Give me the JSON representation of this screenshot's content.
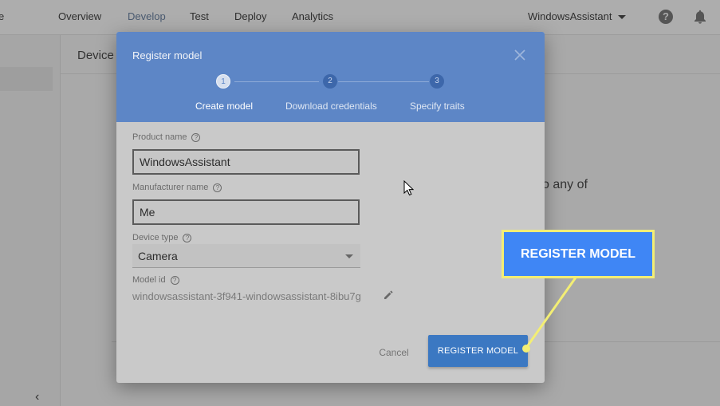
{
  "topnav": {
    "partial_label": "e",
    "items": [
      "Overview",
      "Develop",
      "Test",
      "Deploy",
      "Analytics"
    ],
    "active": "Develop",
    "project": "WindowsAssistant",
    "help_icon": "question-mark-icon",
    "bell_icon": "bell-icon"
  },
  "page": {
    "title": "Device",
    "partial_text": "o any of",
    "collapse_icon": "chevron-left-icon"
  },
  "modal": {
    "title": "Register model",
    "steps": [
      {
        "number": "1",
        "label": "Create model"
      },
      {
        "number": "2",
        "label": "Download credentials"
      },
      {
        "number": "3",
        "label": "Specify traits"
      }
    ],
    "product_name_label": "Product name",
    "product_name_value": "WindowsAssistant",
    "manufacturer_name_label": "Manufacturer name",
    "manufacturer_name_value": "Me",
    "device_type_label": "Device type",
    "device_type_value": "Camera",
    "model_id_label": "Model id",
    "model_id_value": "windowsassistant-3f941-windowsassistant-8ibu7g",
    "cancel_label": "Cancel",
    "register_label": "REGISTER MODEL"
  },
  "callout": {
    "text": "REGISTER MODEL",
    "fill_color": "#3f86f5",
    "border_color": "#f3ee74"
  },
  "colors": {
    "header_blue": "#5d86c6",
    "button_blue": "#3b78c2"
  }
}
